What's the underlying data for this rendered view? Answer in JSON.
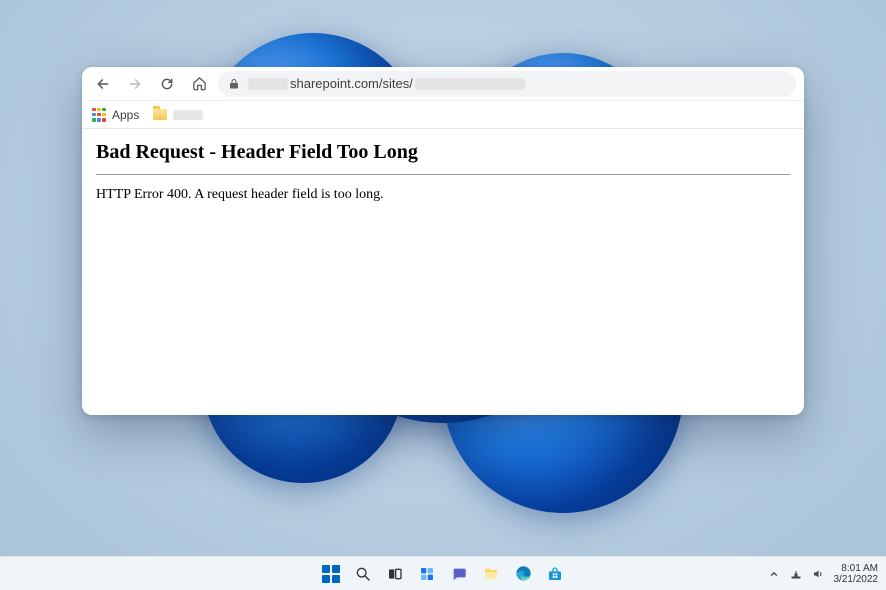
{
  "browser": {
    "nav": {
      "back_title": "Back",
      "forward_title": "Forward",
      "reload_title": "Reload",
      "home_title": "Home"
    },
    "omnibox": {
      "lock_title": "Secure",
      "url_mid": "sharepoint.com/sites/"
    },
    "bookmarks": {
      "apps_label": "Apps"
    }
  },
  "page": {
    "heading": "Bad Request - Header Field Too Long",
    "body": "HTTP Error 400. A request header field is too long."
  },
  "taskbar": {
    "start_title": "Start",
    "search_title": "Search",
    "taskview_title": "Task View",
    "widgets_title": "Widgets",
    "chat_title": "Chat",
    "explorer_title": "File Explorer",
    "edge_title": "Microsoft Edge",
    "store_title": "Microsoft Store"
  },
  "tray": {
    "chevron_title": "Show hidden icons",
    "network_title": "Network",
    "sound_title": "Sound",
    "time": "8:01 AM",
    "date": "3/21/2022"
  }
}
